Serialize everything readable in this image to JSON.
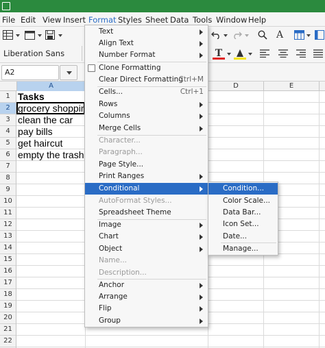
{
  "menubar": {
    "items": [
      "File",
      "Edit",
      "View",
      "Insert",
      "Format",
      "Styles",
      "Sheet",
      "Data",
      "Tools",
      "Window",
      "Help"
    ]
  },
  "font": {
    "name": "Liberation Sans"
  },
  "colors": {
    "accent": "#2a6cc5",
    "title_bar": "#2b8a3e",
    "font_color_swatch": "#e02020",
    "highlight_swatch": "#f5e400"
  },
  "name_box": {
    "value": "A2"
  },
  "columns": [
    "A",
    "D",
    "E"
  ],
  "rows": [
    "1",
    "2",
    "3",
    "4",
    "5",
    "6",
    "7",
    "8",
    "9",
    "10",
    "11",
    "12",
    "13",
    "14",
    "15",
    "16",
    "17",
    "18",
    "19",
    "20",
    "21",
    "22"
  ],
  "cells": [
    "Tasks",
    "grocery shopping",
    "clean the car",
    "pay bills",
    "get haircut",
    "empty the trash"
  ],
  "format_menu": {
    "items": [
      {
        "label": "Text",
        "arrow": true
      },
      {
        "label": "Align Text",
        "arrow": true
      },
      {
        "label": "Number Format",
        "arrow": true
      },
      {
        "label": "Clone Formatting",
        "check": true
      },
      {
        "label": "Clear Direct Formatting",
        "shortcut": "Ctrl+M"
      },
      {
        "label": "Cells...",
        "shortcut": "Ctrl+1"
      },
      {
        "label": "Rows",
        "arrow": true
      },
      {
        "label": "Columns",
        "arrow": true
      },
      {
        "label": "Merge Cells",
        "arrow": true
      },
      {
        "label": "Character...",
        "disabled": true
      },
      {
        "label": "Paragraph...",
        "disabled": true
      },
      {
        "label": "Page Style..."
      },
      {
        "label": "Print Ranges",
        "arrow": true
      },
      {
        "label": "Conditional",
        "arrow": true,
        "highlighted": true
      },
      {
        "label": "AutoFormat Styles...",
        "disabled": true
      },
      {
        "label": "Spreadsheet Theme"
      },
      {
        "label": "Image",
        "arrow": true
      },
      {
        "label": "Chart",
        "arrow": true
      },
      {
        "label": "Object",
        "arrow": true
      },
      {
        "label": "Name...",
        "disabled": true
      },
      {
        "label": "Description...",
        "disabled": true
      },
      {
        "label": "Anchor",
        "arrow": true
      },
      {
        "label": "Arrange",
        "arrow": true
      },
      {
        "label": "Flip",
        "arrow": true
      },
      {
        "label": "Group",
        "arrow": true
      }
    ]
  },
  "conditional_menu": {
    "items": [
      {
        "label": "Condition...",
        "highlighted": true
      },
      {
        "label": "Color Scale..."
      },
      {
        "label": "Data Bar..."
      },
      {
        "label": "Icon Set..."
      },
      {
        "label": "Date..."
      },
      {
        "label": "Manage..."
      }
    ]
  }
}
